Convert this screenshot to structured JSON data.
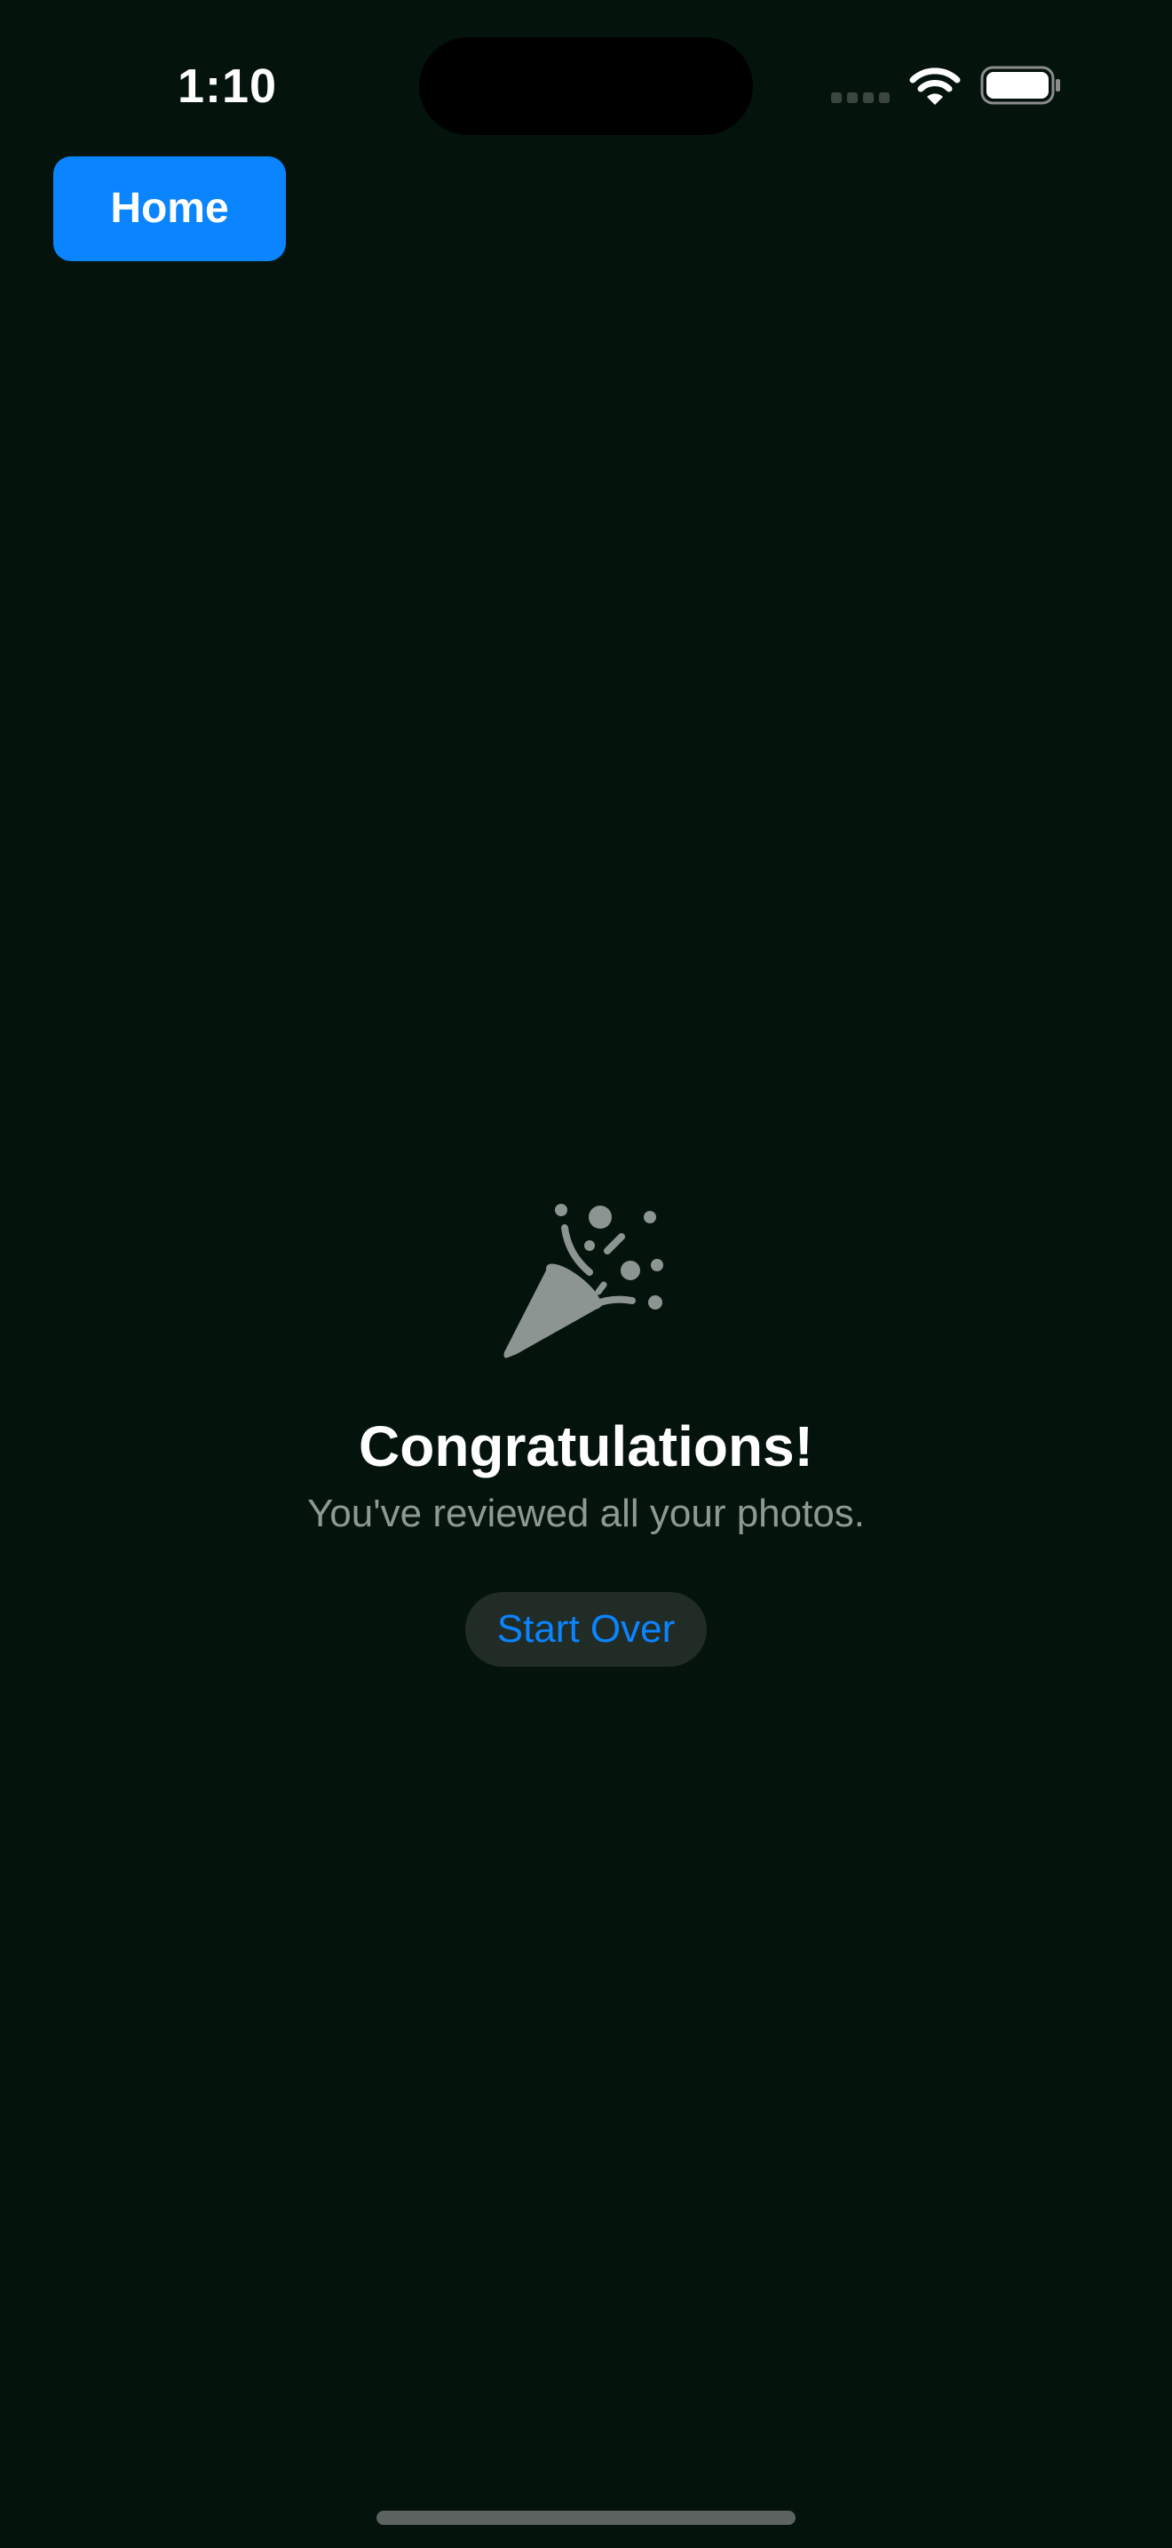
{
  "status_bar": {
    "time": "1:10",
    "icons": [
      "signal-icon",
      "wifi-icon",
      "battery-icon"
    ]
  },
  "nav": {
    "home_label": "Home"
  },
  "completion": {
    "icon": "party-popper-icon",
    "title": "Congratulations!",
    "subtitle": "You've reviewed all your photos.",
    "start_over_label": "Start Over"
  },
  "colors": {
    "background": "#04140c",
    "accent": "#0a84ff",
    "secondary_text": "#8e9993",
    "icon_gray": "#8d9592",
    "pill_background": "#222c27"
  }
}
